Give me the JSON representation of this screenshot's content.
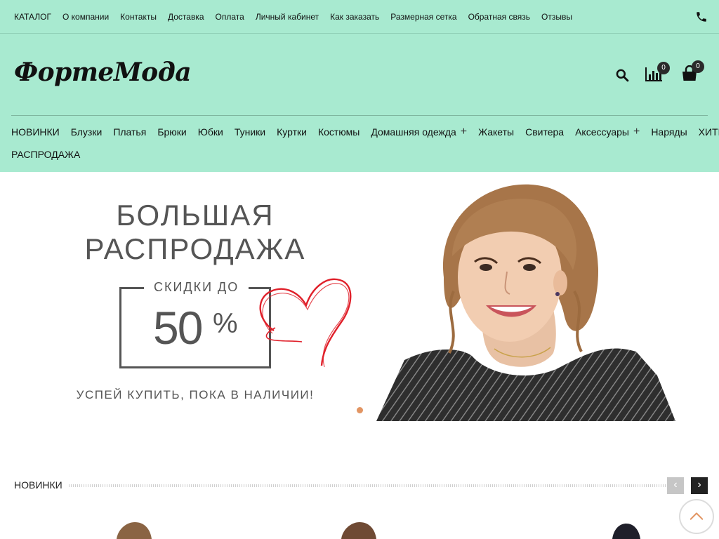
{
  "topnav": {
    "links": [
      "КАТАЛОГ",
      "О компании",
      "Контакты",
      "Доставка",
      "Оплата",
      "Личный кабинет",
      "Как заказать",
      "Размерная сетка",
      "Обратная связь",
      "Отзывы"
    ],
    "phone_icon": "phone-icon"
  },
  "header": {
    "logo": "ФортеМода",
    "compare_count": "0",
    "cart_count": "0",
    "icons": [
      "search-icon",
      "compare-chart-icon",
      "shopping-bag-icon"
    ]
  },
  "mainnav": {
    "row1": [
      {
        "label": "НОВИНКИ",
        "has_sub": false
      },
      {
        "label": "Блузки",
        "has_sub": false
      },
      {
        "label": "Платья",
        "has_sub": false
      },
      {
        "label": "Брюки",
        "has_sub": false
      },
      {
        "label": "Юбки",
        "has_sub": false
      },
      {
        "label": "Туники",
        "has_sub": false
      },
      {
        "label": "Куртки",
        "has_sub": false
      },
      {
        "label": "Костюмы",
        "has_sub": false
      },
      {
        "label": "Домашняя одежда",
        "has_sub": true
      },
      {
        "label": "Жакеты",
        "has_sub": false
      },
      {
        "label": "Свитера",
        "has_sub": false
      },
      {
        "label": "Аксессуары",
        "has_sub": true
      },
      {
        "label": "Наряды",
        "has_sub": false
      },
      {
        "label": "ХИТЫ",
        "has_sub": false
      }
    ],
    "row2": [
      {
        "label": "РАСПРОДАЖА",
        "has_sub": false
      }
    ],
    "plus_glyph": "+"
  },
  "banner": {
    "title_line1": "БОЛЬШАЯ",
    "title_line2": "РАСПРОДАЖА",
    "discount_label": "СКИДКИ ДО",
    "discount_value": "50",
    "discount_sign": "%",
    "footer": "УСПЕЙ КУПИТЬ, ПОКА В НАЛИЧИИ!",
    "slides_total": 1,
    "active_slide": 1,
    "dot_color": "#e29563"
  },
  "section": {
    "title": "НОВИНКИ",
    "prev_label": "‹",
    "next_label": "›"
  },
  "colors": {
    "header_bg": "#a8ead0",
    "text": "#111111",
    "banner_text": "#555555",
    "heart": "#e0202a"
  }
}
